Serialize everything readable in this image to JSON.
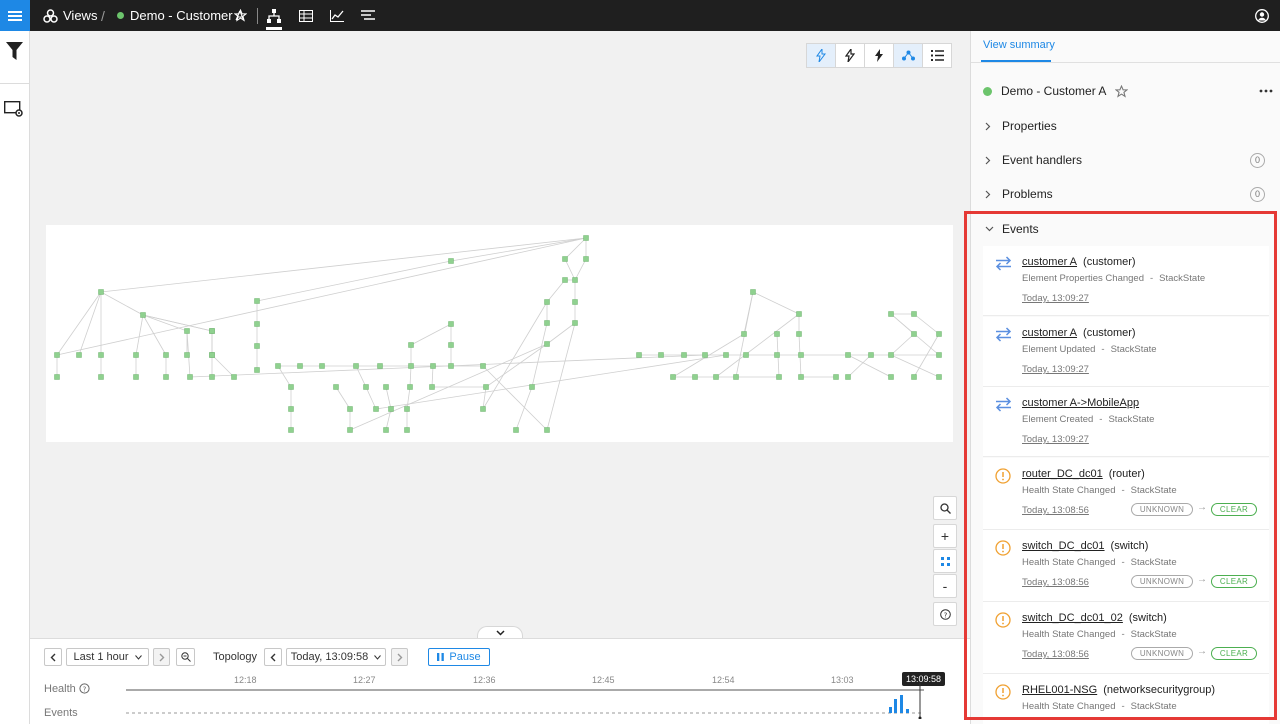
{
  "topbar": {
    "app_name": "Views",
    "separator": "/",
    "view_name": "Demo - Customer A",
    "view_status_color": "#6cc46c",
    "icons": [
      "views-icon",
      "star-icon",
      "topology-icon",
      "table-icon",
      "chart-icon",
      "events-list-icon",
      "user-icon"
    ]
  },
  "leftrail": {
    "icons": [
      "filter-icon",
      "view-settings-icon"
    ]
  },
  "canvas": {
    "toolbar_icons": [
      "indirect-relations-icon",
      "direct-relations-icon",
      "propagation-icon",
      "topology-layout-icon",
      "list-icon"
    ],
    "zoom_controls": [
      "search-icon",
      "+",
      "fit-icon",
      "-",
      "help-icon"
    ]
  },
  "timeline": {
    "range_label": "Last 1 hour",
    "mode_label": "Topology",
    "time_label": "Today, 13:09:58",
    "pause_label": "Pause",
    "ticks": [
      "12:18",
      "12:27",
      "12:36",
      "12:45",
      "12:54",
      "13:03"
    ],
    "current_time": "13:09:58",
    "rows": [
      "Health",
      "Events"
    ]
  },
  "panel": {
    "tab_label": "View summary",
    "view_title": "Demo - Customer A",
    "sections": [
      {
        "label": "Properties",
        "count": ""
      },
      {
        "label": "Event handlers",
        "count": "0"
      },
      {
        "label": "Problems",
        "count": "0"
      }
    ],
    "events_label": "Events",
    "events": [
      {
        "kind": "change",
        "name": "customer A",
        "type": "(customer)",
        "desc": "Element Properties Changed",
        "source": "StackState",
        "time": "Today, 13:09:27"
      },
      {
        "kind": "change",
        "name": "customer A",
        "type": "(customer)",
        "desc": "Element Updated",
        "source": "StackState",
        "time": "Today, 13:09:27"
      },
      {
        "kind": "change",
        "name": "customer A->MobileApp",
        "type": "",
        "desc": "Element Created",
        "source": "StackState",
        "time": "Today, 13:09:27"
      },
      {
        "kind": "health",
        "name": "router_DC_dc01",
        "type": "(router)",
        "desc": "Health State Changed",
        "source": "StackState",
        "time": "Today, 13:08:56",
        "from": "UNKNOWN",
        "to": "CLEAR"
      },
      {
        "kind": "health",
        "name": "switch_DC_dc01",
        "type": "(switch)",
        "desc": "Health State Changed",
        "source": "StackState",
        "time": "Today, 13:08:56",
        "from": "UNKNOWN",
        "to": "CLEAR"
      },
      {
        "kind": "health",
        "name": "switch_DC_dc01_02",
        "type": "(switch)",
        "desc": "Health State Changed",
        "source": "StackState",
        "time": "Today, 13:08:56",
        "from": "UNKNOWN",
        "to": "CLEAR"
      },
      {
        "kind": "health",
        "name": "RHEL001-NSG",
        "type": "(networksecuritygroup)",
        "desc": "Health State Changed",
        "source": "StackState",
        "time": "",
        "from": "",
        "to": ""
      }
    ],
    "source_separator": "-",
    "transition_arrow": "→"
  },
  "colors": {
    "accent": "#1e88e5",
    "node": "#8fd18f",
    "warning": "#f0a030",
    "clear": "#4caf50",
    "highlight": "#e53935"
  }
}
